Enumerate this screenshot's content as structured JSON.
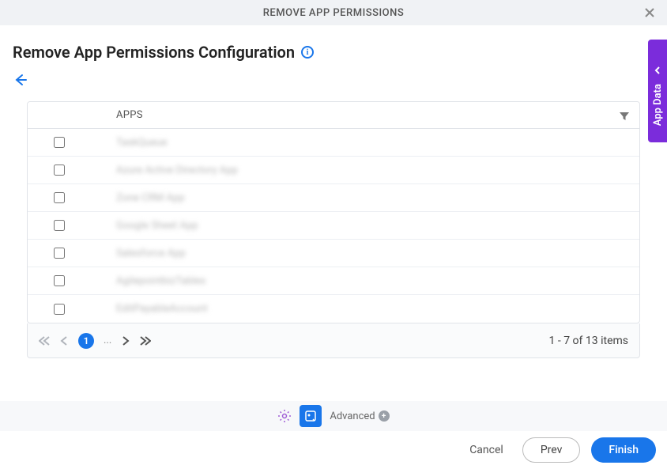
{
  "modal": {
    "title": "REMOVE APP PERMISSIONS"
  },
  "page": {
    "title": "Remove App Permissions Configuration"
  },
  "table": {
    "header": "APPS",
    "rows": [
      {
        "label": "TaskQueue"
      },
      {
        "label": "Azure Active Directory App"
      },
      {
        "label": "Zone CRM App"
      },
      {
        "label": "Google Sheet App"
      },
      {
        "label": "Salesforce App"
      },
      {
        "label": "AgilepointbizTables"
      },
      {
        "label": "EditPayableAccount"
      }
    ]
  },
  "pager": {
    "current": "1",
    "ellipsis": "...",
    "summary": "1 - 7 of 13 items"
  },
  "advanced": {
    "label": "Advanced"
  },
  "actions": {
    "cancel": "Cancel",
    "prev": "Prev",
    "finish": "Finish"
  },
  "sideTab": {
    "label": "App Data"
  }
}
